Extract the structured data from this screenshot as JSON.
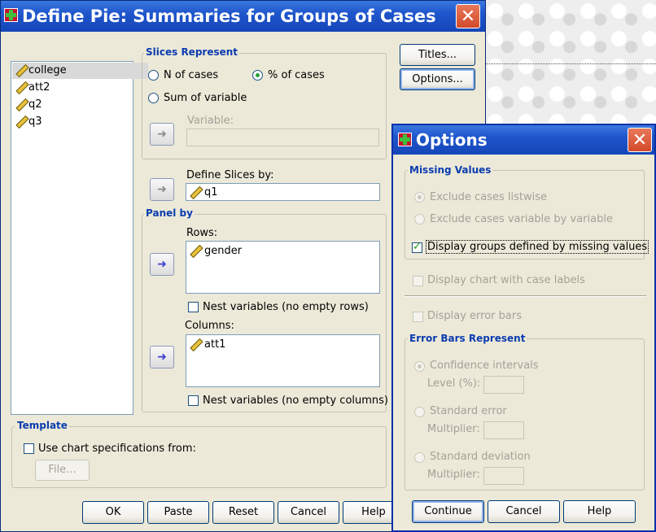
{
  "main_dialog": {
    "title": "Define Pie: Summaries for Groups of Cases",
    "close_glyph": "✕",
    "variables": [
      "college",
      "att2",
      "q2",
      "q3"
    ],
    "slices_represent": {
      "label": "Slices Represent",
      "n_cases": "N of cases",
      "pct_cases": "% of cases",
      "sum_var": "Sum of variable",
      "variable_label": "Variable:",
      "selected": "% of cases"
    },
    "define_slices": {
      "label": "Define Slices by:",
      "value": "q1"
    },
    "panel_by": {
      "label": "Panel by",
      "rows_label": "Rows:",
      "rows_value": "gender",
      "nest_rows": "Nest variables (no empty rows)",
      "cols_label": "Columns:",
      "cols_value": "att1",
      "nest_cols": "Nest variables (no empty columns)"
    },
    "template": {
      "label": "Template",
      "use_spec": "Use chart specifications from:",
      "file_btn": "File..."
    },
    "buttons": {
      "titles": "Titles...",
      "options": "Options...",
      "ok": "OK",
      "paste": "Paste",
      "reset": "Reset",
      "cancel": "Cancel",
      "help": "Help"
    },
    "arrow_glyph": "➜"
  },
  "options_dialog": {
    "title": "Options",
    "close_glyph": "✕",
    "missing_values": {
      "label": "Missing Values",
      "listwise": "Exclude cases listwise",
      "var_by_var": "Exclude cases variable by variable",
      "display_groups": "Display groups defined by missing values",
      "display_groups_checked": true
    },
    "case_labels": "Display chart with case labels",
    "error_bars": "Display error bars",
    "error_bars_represent": {
      "label": "Error Bars Represent",
      "ci": "Confidence intervals",
      "level": "Level (%):",
      "se": "Standard error",
      "se_mult": "Multiplier:",
      "sd": "Standard deviation",
      "sd_mult": "Multiplier:"
    },
    "buttons": {
      "continue": "Continue",
      "cancel": "Cancel",
      "help": "Help"
    }
  }
}
